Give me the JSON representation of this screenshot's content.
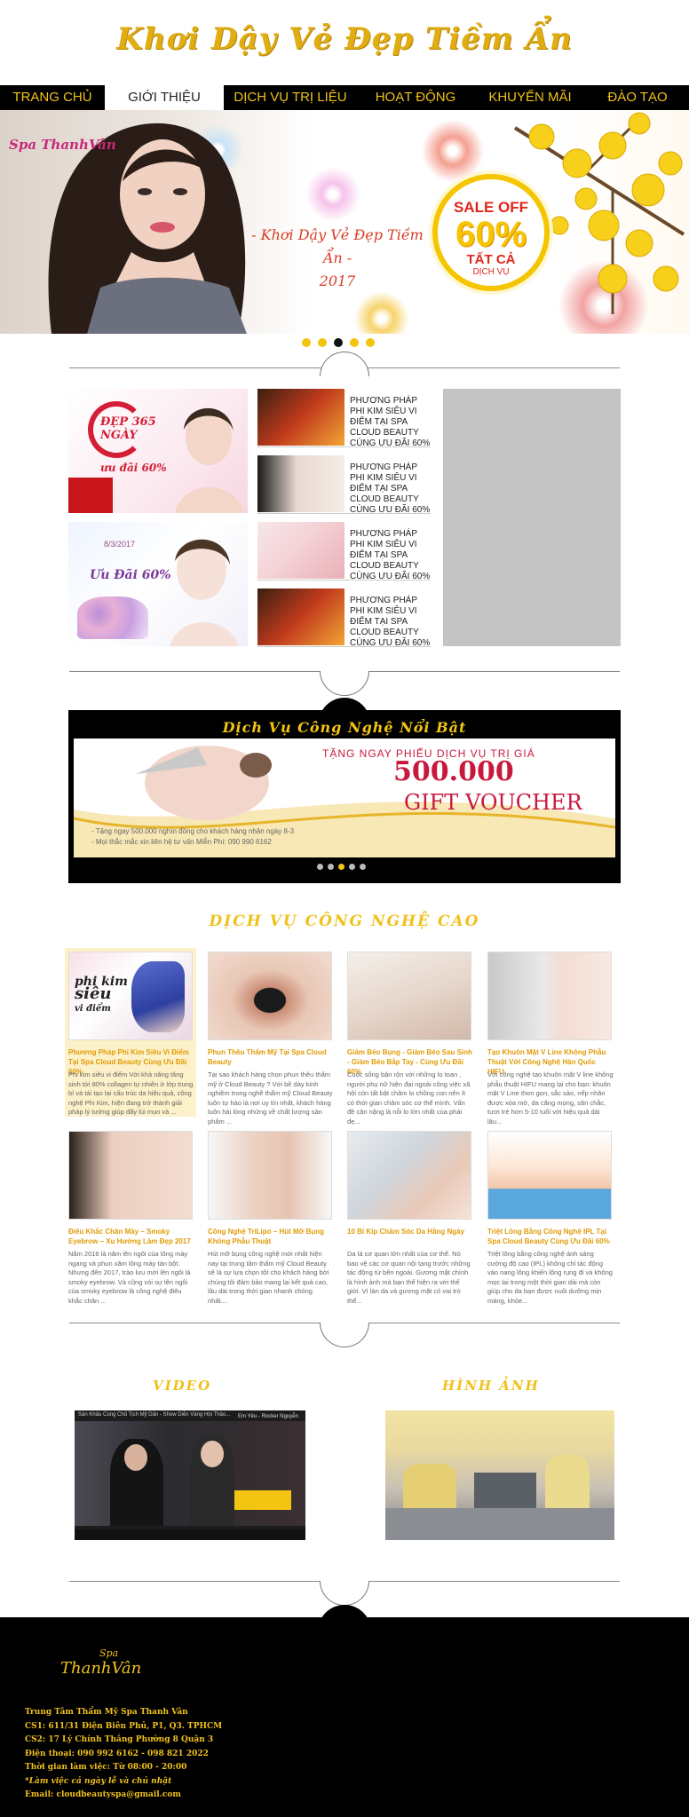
{
  "header": {
    "slogan": "Khơi Dậy Vẻ Đẹp Tiềm Ẩn"
  },
  "nav": {
    "items": [
      {
        "label": "TRANG CHỦ"
      },
      {
        "label": "GIỚI THIỆU"
      },
      {
        "label": "DỊCH VỤ TRỊ LIỆU"
      },
      {
        "label": "HOẠT ĐỘNG"
      },
      {
        "label": "KHUYẾN MÃI"
      },
      {
        "label": "ĐÀO TẠO"
      }
    ],
    "active_index": 1
  },
  "banner": {
    "brand": "Spa ThanhVân",
    "tagline": "- Khơi Dậy Vẻ Đẹp Tiềm Ẩn -",
    "year": "2017",
    "sale_off": "SALE OFF",
    "sale_pct": "60%",
    "sale_all": "TẤT CẢ",
    "sale_sub": "DỊCH VỤ",
    "slide_count": 5,
    "active_slide": 2
  },
  "promo": {
    "big1_text": "ĐẸP 365 NGÀY",
    "big1_sub": "ưu đãi 60%",
    "big2_date": "8/3/2017",
    "big2_text": "Ưu Đãi 60%",
    "items": [
      {
        "title": "PHƯƠNG PHÁP PHI KIM SIÊU VI ĐIỂM TẠI SPA CLOUD BEAUTY CÙNG ƯU ĐÃI 60%"
      },
      {
        "title": "PHƯƠNG PHÁP PHI KIM SIÊU VI ĐIỂM TẠI SPA CLOUD BEAUTY CÙNG ƯU ĐÃI 60%"
      },
      {
        "title": "PHƯƠNG PHÁP PHI KIM SIÊU VI ĐIỂM TẠI SPA CLOUD BEAUTY CÙNG ƯU ĐÃI 60%"
      },
      {
        "title": "PHƯƠNG PHÁP PHI KIM SIÊU VI ĐIỂM TẠI SPA CLOUD BEAUTY CÙNG ƯU ĐÃI 60%"
      }
    ]
  },
  "featured": {
    "title": "Dịch Vụ Công Nghệ Nổi Bật",
    "voucher_top": "TẶNG NGAY PHIẾU DỊCH VỤ TRỊ GIÁ",
    "voucher_amount": "500.000",
    "voucher_gift": "GIFT VOUCHER",
    "line1": "- Tặng ngay 500.000 nghìn đồng cho khách hàng nhân ngày 8-3",
    "line2": "- Mọi thắc mắc xin liên hệ tư vấn Miễn Phí: 090 990 6162",
    "slide_count": 5,
    "active_slide": 2
  },
  "hitech": {
    "title": "DỊCH VỤ CÔNG NGHỆ CAO",
    "cards": [
      {
        "title": "Phương Pháp Phi Kim Siêu Vi Điểm Tại Spa Cloud Beauty Cùng Ưu Đãi 60%",
        "desc": "Phi kim siêu vi điểm Với khả năng tăng sinh tới 80% collagen tự nhiên ở lớp trung bì và tái tạo lại cấu trúc da hiệu quả, công nghệ Phi Kim, hiện đang trở thành giải pháp lý tưởng giúp đẩy lùi mụn và ..."
      },
      {
        "title": "Phun Thêu Thẩm Mỹ Tại Spa Cloud Beauty",
        "desc": "Tại sao khách hàng chọn phun thêu thẩm mỹ ở Cloud Beauty ? Với bề dày kinh nghiệm trong nghề thẩm mỹ Cloud Beauty luôn tự hào là nơi uy tín nhất, khách hàng luôn hài lòng những về chất lượng sản phẩm ..."
      },
      {
        "title": "Giảm Béo Bụng - Giảm Béo Sau Sinh - Giảm Béo Bắp Tay - Cùng Ưu Đãi 60%",
        "desc": "Cuộc sống bận rộn với những lo toan , người phụ nữ hiện đại ngoài công việc xã hội còn tất bật chăm lo chồng con nên ít có thời gian chăm sóc cơ thể mình. Vấn đề cân nặng là nỗi lo lớn nhất của phái đẹ..."
      },
      {
        "title": "Tạo Khuôn Mặt V Line Không Phẫu Thuật Với Công Nghệ Hàn Quốc HIFU",
        "desc": "Với công nghệ tạo khuôn mặt V line không phẫu thuật HIFU mang lại cho bạn: khuôn mặt V Line thon gọn, sắc sảo, nếp nhăn được xóa mờ, da căng mọng, săn chắc, tươi trẻ hơn 5-10 tuổi với hiệu quả dài lâu..."
      },
      {
        "title": "Điêu Khắc Chân Mày – Smoky Eyebrow – Xu Hướng Làm Đẹp 2017",
        "desc": "Năm 2016 là năm lên ngôi của lông mày ngang và phun xăm lông mày tán bột. Nhưng đến 2017, trào lưu mới lên ngôi là smoky eyebrow. Và cũng vói sự lên ngôi của smoky eyebrow là công nghệ điêu khắc chân ..."
      },
      {
        "title": "Công Nghệ TriLipo – Hút Mỡ Bụng Không Phẫu Thuật",
        "desc": "Hút mỡ bụng công nghệ mới nhất hiện nay tại trung tâm thẩm mỹ Cloud Beauty sẽ là sự lựa chọn tốt cho khách hàng bởi chúng tôi đảm bảo mang lại kết quả cao, lâu dài trong thời gian nhanh chóng nhất...."
      },
      {
        "title": "10 Bí Kíp Chăm Sóc Da Hằng Ngày",
        "desc": "Da là cơ quan lớn nhất của cơ thể. Nó bao vệ các cơ quan nội tạng trước những tác động từ bên ngoài. Gương mặt chính là hình ảnh mà bạn thể hiện ra với thế giới. Vì làn da và gương mặt có vai trò thể..."
      },
      {
        "title": "Triệt Lông Bằng Công Nghệ IPL Tại Spa Cloud Beauty Cùng Ưu Đãi 60%",
        "desc": "Triệt lông bằng công nghệ ánh sáng cường độ cao (IPL) không chỉ tác động vào nang lông khiến lông rụng đi và không mọc lại trong một thời gian dài mà còn giúp cho da bạn được nuôi dưỡng mịn màng, khỏe..."
      }
    ]
  },
  "media": {
    "video_title": "VIDEO",
    "images_title": "HÌNH ẢNH",
    "video_caption": "Sân Khấu Cùng Chủ Tịch Mỹ Dân - Show Diễn Vàng Hội Thảo...",
    "video_person": "Em Yêu - Rocker Nguyễn"
  },
  "footer": {
    "logo": "ThanhVân",
    "logo_small": "Spa",
    "lines": [
      "Trung Tâm Thẩm Mỹ Spa Thanh Vân",
      "CS1: 611/31 Điện Biên Phủ, P1, Q3. TPHCM",
      "CS2: 17 Lý Chính Thắng Phường 8 Quận 3",
      "Điện thoại: 090 992 6162 - 098 821  2022",
      "Thời gian làm việc: Từ 08:00 - 20:00",
      "*Làm việc cả ngày lễ và chủ nhật",
      "Email: cloudbeautyspa@gmail.com"
    ]
  },
  "colors": {
    "gold": "#f0c11c",
    "black": "#000000",
    "red": "#d63d25"
  }
}
